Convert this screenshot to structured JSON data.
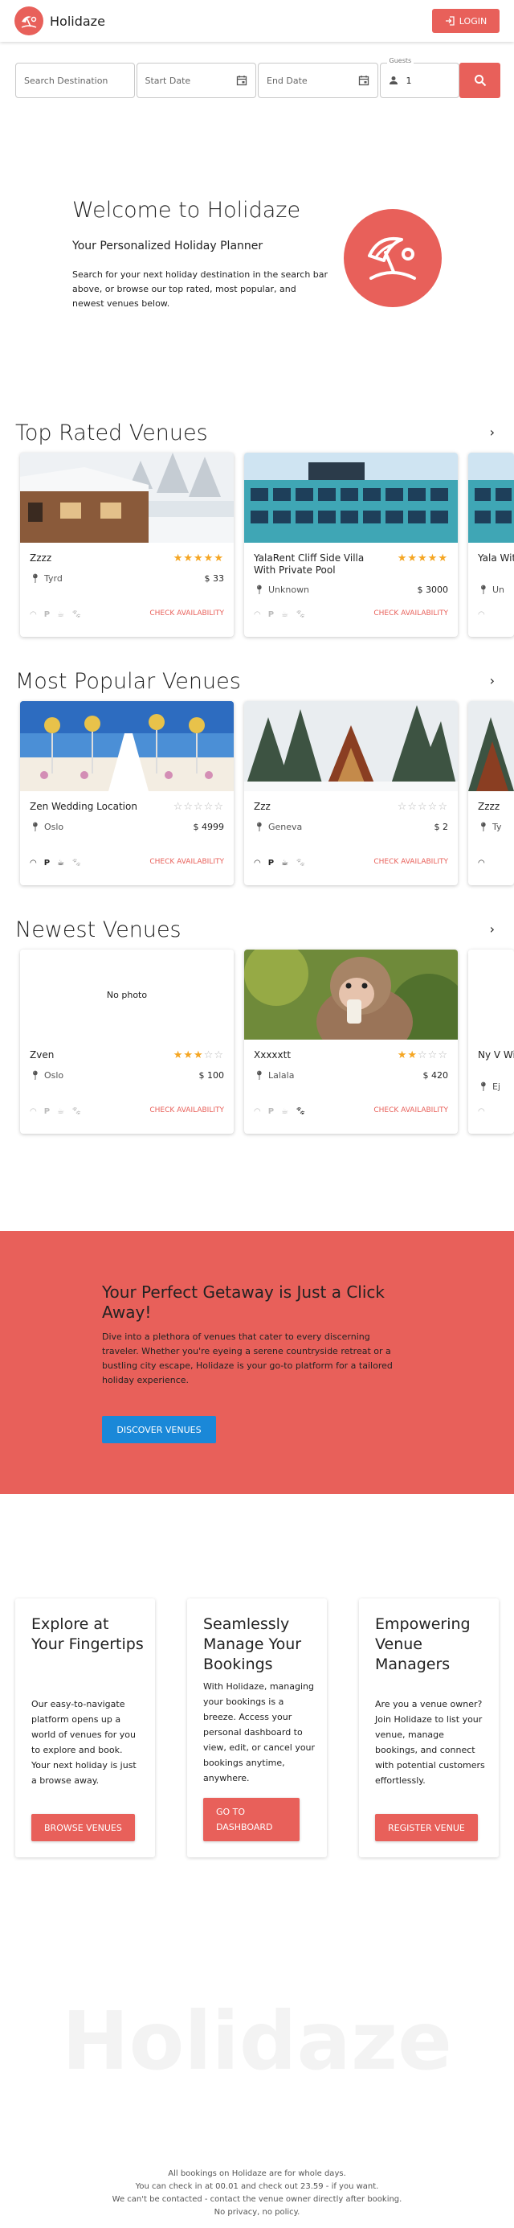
{
  "app": {
    "brand": "Holidaze",
    "login_label": "LOGIN"
  },
  "search": {
    "destination_placeholder": "Search Destination",
    "start_placeholder": "Start Date",
    "end_placeholder": "End Date",
    "guests_label": "Guests",
    "guests_value": "1"
  },
  "hero": {
    "title": "Welcome to Holidaze",
    "subtitle": "Your Personalized Holiday Planner",
    "text": "Search for your next holiday destination in the search bar above, or browse our top rated, most popular, and newest venues below."
  },
  "sections": [
    {
      "title": "Top Rated Venues",
      "cards": [
        {
          "name": "Zzzz",
          "rating": 5,
          "location": "Tyrd",
          "price": "$ 33",
          "amenities": [
            false,
            false,
            false,
            false
          ],
          "image": "winter-cabin",
          "cta": "CHECK AVAILABILITY"
        },
        {
          "name": "YalaRent Cliff Side Villa With Private Pool",
          "rating": 5,
          "location": "Unknown",
          "price": "$ 3000",
          "amenities": [
            false,
            false,
            false,
            false
          ],
          "image": "building",
          "cta": "CHECK AVAILABILITY"
        },
        {
          "name": "Yala With",
          "rating": 0,
          "location": "Un",
          "price": "",
          "amenities": [
            false
          ],
          "image": "building",
          "cta": ""
        }
      ]
    },
    {
      "title": "Most Popular Venues",
      "cards": [
        {
          "name": "Zen Wedding Location",
          "rating": 0,
          "location": "Oslo",
          "price": "$ 4999",
          "amenities": [
            true,
            true,
            true,
            false
          ],
          "image": "wedding",
          "cta": "CHECK AVAILABILITY"
        },
        {
          "name": "Zzz",
          "rating": 0,
          "location": "Geneva",
          "price": "$ 2",
          "amenities": [
            true,
            true,
            true,
            false
          ],
          "image": "a-frame",
          "cta": "CHECK AVAILABILITY"
        },
        {
          "name": "Zzzz",
          "rating": 0,
          "location": "Ty",
          "price": "",
          "amenities": [
            true
          ],
          "image": "a-frame",
          "cta": ""
        }
      ]
    },
    {
      "title": "Newest Venues",
      "cards": [
        {
          "name": "Zven",
          "rating": 3,
          "location": "Oslo",
          "price": "$ 100",
          "amenities": [
            false,
            false,
            false,
            false
          ],
          "image": "none",
          "no_photo": "No photo",
          "cta": "CHECK AVAILABILITY"
        },
        {
          "name": "Xxxxxtt",
          "rating": 2,
          "location": "Lalala",
          "price": "$ 420",
          "amenities": [
            false,
            false,
            false,
            true
          ],
          "image": "monkey",
          "cta": "CHECK AVAILABILITY"
        },
        {
          "name": "Ny V With",
          "rating": 0,
          "location": "Ej",
          "price": "",
          "amenities": [
            false
          ],
          "image": "monkey",
          "cta": ""
        }
      ]
    }
  ],
  "promo": {
    "title": "Your Perfect Getaway is Just a Click Away!",
    "text": "Dive into a plethora of venues that cater to every discerning traveler. Whether you're eyeing a serene countryside retreat or a bustling city escape, Holidaze is your go-to platform for a tailored holiday experience.",
    "button": "DISCOVER VENUES"
  },
  "features": [
    {
      "title": "Explore at Your Fingertips",
      "text": "Our easy-to-navigate platform opens up a world of venues for you to explore and book. Your next holiday is just a browse away.",
      "button": "BROWSE VENUES"
    },
    {
      "title": "Seamlessly Manage Your Bookings",
      "text": "With Holidaze, managing your bookings is a breeze. Access your personal dashboard to view, edit, or cancel your bookings anytime, anywhere.",
      "button": "GO TO DASHBOARD"
    },
    {
      "title": "Empowering Venue Managers",
      "text": "Are you a venue owner? Join Holidaze to list your venue, manage bookings, and connect with potential customers effortlessly.",
      "button": "REGISTER VENUE"
    }
  ],
  "footer": {
    "watermark": "Holidaze",
    "lines": [
      "All bookings on Holidaze are for whole days.",
      "You can check in at 00.01 and check out 23.59 - if you want.",
      "We can't be contacted - contact the venue owner directly after booking.",
      "No privacy, no policy."
    ]
  },
  "colors": {
    "accent": "#e8605a",
    "promo_button": "#1a88d8",
    "star": "#f5a623"
  }
}
